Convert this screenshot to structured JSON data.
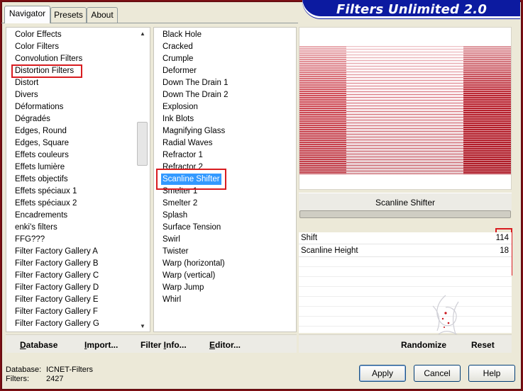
{
  "window": {
    "title": "Filters Unlimited 2.0"
  },
  "tabs": [
    {
      "label": "Navigator",
      "active": true
    },
    {
      "label": "Presets",
      "active": false
    },
    {
      "label": "About",
      "active": false
    }
  ],
  "categories": {
    "items": [
      "Color Effects",
      "Color Filters",
      "Convolution Filters",
      "Distortion Filters",
      "Distort",
      "Divers",
      "Déformations",
      "Dégradés",
      "Edges, Round",
      "Edges, Square",
      "Effets couleurs",
      "Effets lumière",
      "Effets objectifs",
      "Effets spéciaux 1",
      "Effets spéciaux 2",
      "Encadrements",
      "enki's filters",
      "FFG???",
      "Filter Factory Gallery A",
      "Filter Factory Gallery B",
      "Filter Factory Gallery C",
      "Filter Factory Gallery D",
      "Filter Factory Gallery E",
      "Filter Factory Gallery F",
      "Filter Factory Gallery G"
    ],
    "highlighted": "Distortion Filters"
  },
  "filters": {
    "items": [
      "Black Hole",
      "Cracked",
      "Crumple",
      "Deformer",
      "Down The Drain 1",
      "Down The Drain 2",
      "Explosion",
      "Ink Blots",
      "Magnifying Glass",
      "Radial Waves",
      "Refractor 1",
      "Refractor 2",
      "Scanline Shifter",
      "Smelter 1",
      "Smelter 2",
      "Splash",
      "Surface Tension",
      "Swirl",
      "Twister",
      "Warp (horizontal)",
      "Warp (vertical)",
      "Warp Jump",
      "Whirl"
    ],
    "selected": "Scanline Shifter"
  },
  "preview": {
    "filter_name": "Scanline Shifter",
    "colors": {
      "dark_red": "#b7212d",
      "mid_red": "#cf4a55",
      "light_pink": "#f3d9dc"
    }
  },
  "params": [
    {
      "label": "Shift",
      "value": "114"
    },
    {
      "label": "Scanline Height",
      "value": "18"
    }
  ],
  "left_toolbar": {
    "database": {
      "ul": "D",
      "rest": "atabase"
    },
    "import": {
      "ul": "I",
      "rest": "mport..."
    },
    "filter_info": {
      "pre": "Filter ",
      "ul": "I",
      "rest": "nfo..."
    },
    "editor": {
      "ul": "E",
      "rest": "ditor..."
    }
  },
  "right_toolbar": {
    "randomize": "Randomize",
    "reset": "Reset"
  },
  "status": {
    "database_label": "Database:",
    "database_value": "ICNET-Filters",
    "filters_label": "Filters:",
    "filters_value": "2427"
  },
  "buttons": {
    "apply": "Apply",
    "cancel": "Cancel",
    "help": "Help"
  },
  "accent": {
    "highlight_red": "#d81c20",
    "selection_blue": "#3399ff",
    "banner_blue": "#0c1aa0"
  }
}
